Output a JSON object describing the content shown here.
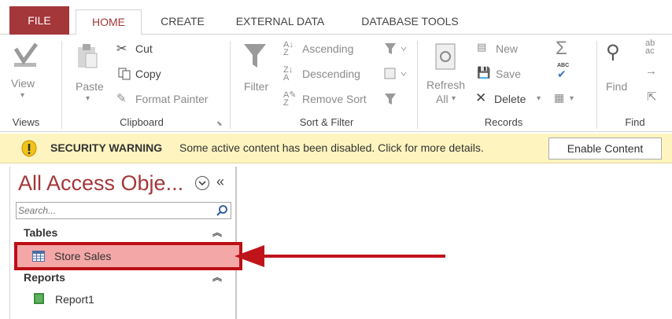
{
  "tabs": {
    "file": "FILE",
    "home": "HOME",
    "create": "CREATE",
    "external_data": "EXTERNAL DATA",
    "database_tools": "DATABASE TOOLS"
  },
  "ribbon": {
    "views": {
      "view": "View",
      "label": "Views"
    },
    "clipboard": {
      "paste": "Paste",
      "cut": "Cut",
      "copy": "Copy",
      "format_painter": "Format Painter",
      "label": "Clipboard"
    },
    "sort_filter": {
      "filter": "Filter",
      "ascending": "Ascending",
      "descending": "Descending",
      "remove_sort": "Remove Sort",
      "label": "Sort & Filter"
    },
    "records": {
      "refresh": "Refresh",
      "refresh_all": "All",
      "new": "New",
      "save": "Save",
      "delete": "Delete",
      "label": "Records"
    },
    "find": {
      "find": "Find",
      "label": "Find"
    }
  },
  "security": {
    "title": "SECURITY WARNING",
    "message": "Some active content has been disabled. Click for more details.",
    "enable_button": "Enable Content"
  },
  "nav": {
    "title": "All Access Obje...",
    "collapse": "«",
    "search_placeholder": "Search...",
    "sections": [
      {
        "label": "Tables",
        "items": [
          {
            "label": "Store Sales",
            "icon": "table-icon",
            "selected": true
          }
        ]
      },
      {
        "label": "Reports",
        "items": [
          {
            "label": "Report1",
            "icon": "report-icon",
            "selected": false
          }
        ]
      }
    ]
  },
  "colors": {
    "accent": "#a4373a",
    "warning_bg": "#fdf4bf",
    "selection_fill": "#f4a7a7",
    "selection_border": "#bc0f14"
  }
}
